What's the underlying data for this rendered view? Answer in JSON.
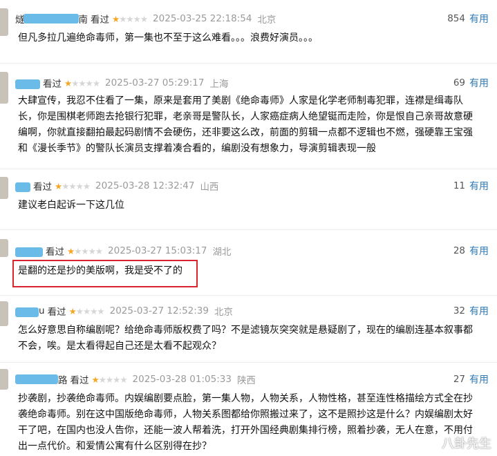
{
  "comments": [
    {
      "user": "燧",
      "user_tail": "南",
      "watched": "看过",
      "stars": 1,
      "time": "2025-03-25 22:18:54",
      "location": "北京",
      "votes": "854",
      "useful": "有用",
      "text": "但凡多拉几遍绝命毒师，第一集也不至于这么难看。。。浪费好演员。。。"
    },
    {
      "user": "",
      "user_tail": "",
      "watched": "看过",
      "stars": 1,
      "time": "2025-03-27 05:29:17",
      "location": "上海",
      "votes": "69",
      "useful": "有用",
      "text": "大肆宣传，我忍不住看了一集，原来是套用了美剧《绝命毒师》人家是化学老师制毒犯罪，连襟是缉毒队长，你是围棋老师跑去抢银行犯罪，老亲哥是警队长，人家癌症病人绝望铤而走险，你是恨自己亲哥故意硬编啊，你就直接翻拍最起码剧情不会硬伤，还非要这么改，前面的剪辑一点都不逻辑也不燃，强硬靠王宝强和《漫长季节》的警队长演员支撑着凑合看的，编剧没有想象力，导演剪辑表现一般"
    },
    {
      "user": "",
      "user_tail": "",
      "watched": "看过",
      "stars": 1,
      "time": "2025-03-28 12:32:47",
      "location": "山西",
      "votes": "11",
      "useful": "有用",
      "text": "建议老白起诉一下这几位"
    },
    {
      "user": "",
      "user_tail": "",
      "watched": "看过",
      "stars": 1,
      "time": "2025-03-27 15:03:17",
      "location": "湖北",
      "votes": "28",
      "useful": "有用",
      "text": "是翻的还是抄的美版啊，我是受不了的"
    },
    {
      "user": "",
      "user_tail": "u",
      "watched": "看过",
      "stars": 1,
      "time": "2025-03-27 12:52:39",
      "location": "北京",
      "votes": "32",
      "useful": "有用",
      "text": "怎么好意思自称编剧呢？给绝命毒师版权费了吗？不是滤镜灰突突就是悬疑剧了，现在的编剧连基本叙事都不会，唉。是太看得起自己还是太看不起观众？"
    },
    {
      "user": "",
      "user_tail": "路",
      "watched": "看过",
      "stars": 1,
      "time": "2025-03-28 01:05:33",
      "location": "陕西",
      "votes": "27",
      "useful": "有用",
      "text": "抄袭剧，抄袭绝命毒师。内娱编剧要点脸，第一集人物，人物关系，人物性格，甚至连性格描绘方式全在抄袭绝命毒师。别在这中国版绝命毒师，人物关系图都给你照搬过来了，这不是照抄这是什么？内娱编剧太好干了吧，在国内也没人告你，还能一波人帮着洗，打开外国经典剧集排行榜，照着抄袭，无人在意，不用付出一点代价。和爱情公寓有什么区别得在抄？"
    }
  ],
  "watermark": "八卦先生",
  "colors": {
    "star_on": "#f5a623",
    "star_off": "#d6d6d6",
    "useful": "#2d7ab6",
    "highlight_box": "#d9232d",
    "user_blur": "#5ab4e6"
  }
}
